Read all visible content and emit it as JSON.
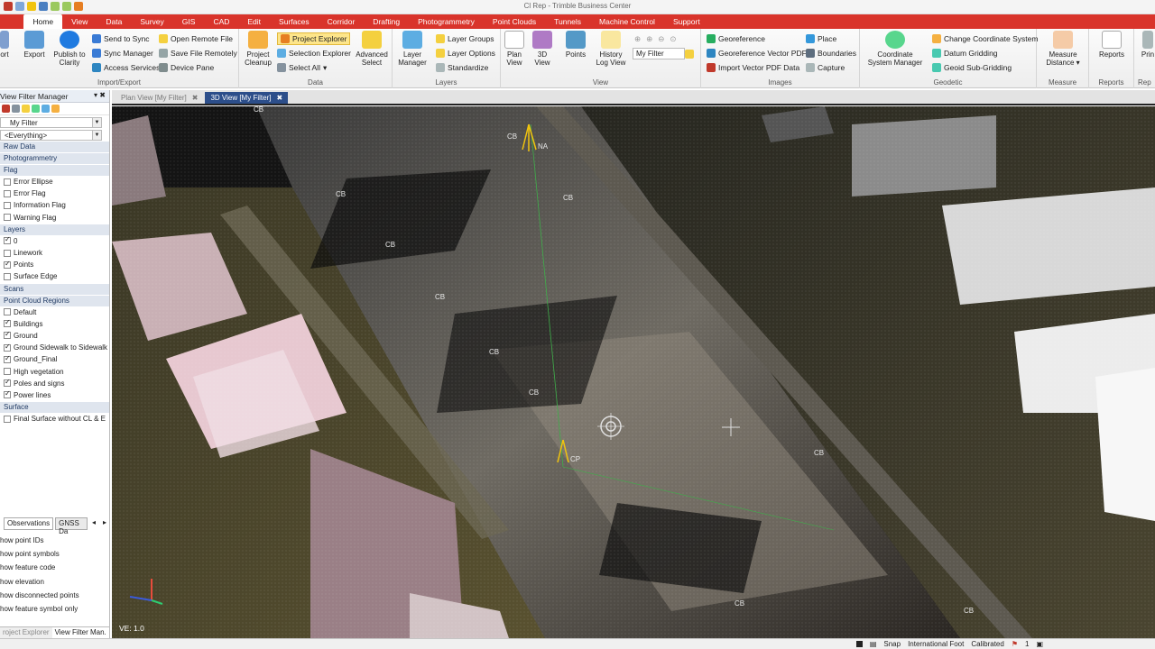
{
  "window": {
    "title": "Cl Rep - Trimble Business Center"
  },
  "tabs": [
    "Home",
    "View",
    "Data",
    "Survey",
    "GIS",
    "CAD",
    "Edit",
    "Surfaces",
    "Corridor",
    "Drafting",
    "Photogrammetry",
    "Point Clouds",
    "Tunnels",
    "Machine Control",
    "Support"
  ],
  "active_tab": "Home",
  "ribbon": {
    "import_export": {
      "name": "Import/Export",
      "ort": "ort",
      "export": "Export",
      "publish": "Publish to Clarity",
      "send_to_sync": "Send to Sync",
      "sync_manager": "Sync Manager",
      "access_services": "Access Services",
      "open_remote": "Open Remote File",
      "save_remote": "Save File Remotely",
      "device_pane": "Device Pane"
    },
    "data": {
      "name": "Data",
      "project_cleanup": "Project Cleanup",
      "project_explorer": "Project Explorer",
      "selection_explorer": "Selection Explorer",
      "select_all": "Select All",
      "advanced_select": "Advanced Select"
    },
    "layers": {
      "name": "Layers",
      "layer_manager": "Layer Manager",
      "layer_groups": "Layer Groups",
      "layer_options": "Layer Options",
      "standardize": "Standardize"
    },
    "view": {
      "name": "View",
      "plan_view": "Plan View",
      "view_3d": "3D View",
      "points": "Points",
      "history_log": "History Log View",
      "filter": "My Filter"
    },
    "images": {
      "name": "Images",
      "georeference": "Georeference",
      "georeference_pdf": "Georeference Vector PDF",
      "import_pdf": "Import Vector PDF Data",
      "place": "Place",
      "boundaries": "Boundaries",
      "capture": "Capture"
    },
    "geodetic": {
      "name": "Geodetic",
      "coord_manager": "Coordinate System Manager",
      "change_coord": "Change Coordinate System",
      "datum_grid": "Datum Gridding",
      "geoid_grid": "Geoid Sub-Gridding"
    },
    "measure": {
      "name": "Measure",
      "measure_distance": "Measure Distance"
    },
    "reports": {
      "name": "Reports",
      "reports": "Reports"
    },
    "print": {
      "label": "Prin",
      "sublabel": "Rep"
    }
  },
  "left_panel": {
    "title": "View Filter Manager",
    "filter": "My Filter",
    "everything": "<Everything>",
    "sections": {
      "raw_data": "Raw Data",
      "photogrammetry": "Photogrammetry",
      "flag": "Flag",
      "layers": "Layers",
      "scans": "Scans",
      "pc_regions": "Point Cloud Regions",
      "surface": "Surface"
    },
    "flag_items": [
      {
        "label": "Error Ellipse",
        "checked": false
      },
      {
        "label": "Error Flag",
        "checked": false
      },
      {
        "label": "Information Flag",
        "checked": false
      },
      {
        "label": "Warning Flag",
        "checked": false
      }
    ],
    "layer_items": [
      {
        "label": "0",
        "checked": true
      },
      {
        "label": "Linework",
        "checked": false
      },
      {
        "label": "Points",
        "checked": true
      },
      {
        "label": "Surface Edge",
        "checked": false
      }
    ],
    "region_items": [
      {
        "label": "Default",
        "checked": false
      },
      {
        "label": "Buildings",
        "checked": true
      },
      {
        "label": "Ground",
        "checked": true
      },
      {
        "label": "Ground Sidewalk to Sidewalk",
        "checked": true
      },
      {
        "label": "Ground_Final",
        "checked": true
      },
      {
        "label": "High vegetation",
        "checked": false
      },
      {
        "label": "Poles and signs",
        "checked": true
      },
      {
        "label": "Power lines",
        "checked": true
      }
    ],
    "surface_items": [
      {
        "label": "Final Surface without CL & E",
        "checked": false
      }
    ],
    "sub_tabs": [
      "Observations",
      "GNSS Da"
    ],
    "options": [
      "how point IDs",
      "how point symbols",
      "how feature code",
      "how elevation",
      "how disconnected points",
      "how feature symbol only"
    ],
    "bottom_tabs": [
      "roject Explorer",
      "View Filter Man."
    ]
  },
  "doc_tabs": [
    {
      "label": "Plan View [My Filter]",
      "active": false
    },
    {
      "label": "3D View [My Filter]",
      "active": true
    }
  ],
  "viewport": {
    "ve_label": "VE: 1.0",
    "labels": [
      "CB",
      "CB",
      "CB",
      "CB",
      "CB",
      "CB",
      "CB",
      "CB",
      "CB",
      "CB",
      "CP",
      "CB",
      "NA"
    ]
  },
  "statusbar": {
    "snap": "Snap",
    "units": "International Foot",
    "calibrated": "Calibrated",
    "count": "1"
  },
  "colors": {
    "ribbon_red": "#d9342b",
    "active_doc_tab": "#2c4e8a"
  }
}
